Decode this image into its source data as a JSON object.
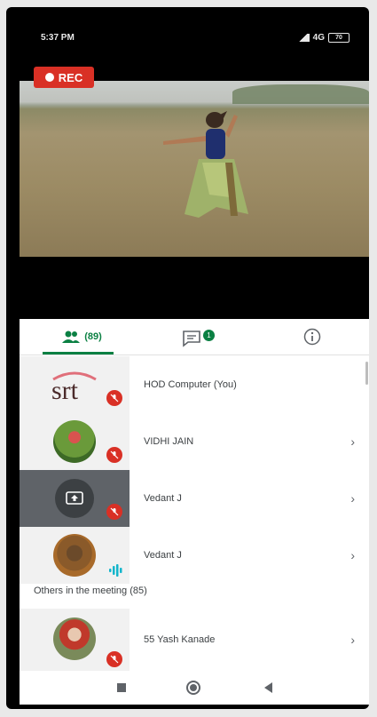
{
  "status_bar": {
    "time": "5:37 PM",
    "network": "4G",
    "battery": "70"
  },
  "recording": {
    "label": "REC"
  },
  "tabs": {
    "people_count": "(89)",
    "chat_badge": "1"
  },
  "participants": [
    {
      "name": "HOD Computer (You)",
      "avatar": "srt-logo",
      "muted": true
    },
    {
      "name": "VIDHI JAIN",
      "avatar": "photo",
      "muted": true
    },
    {
      "name": "Vedant J",
      "avatar": "screen-share-icon",
      "muted": true
    },
    {
      "name": "Vedant J",
      "avatar": "photo",
      "muted": false
    }
  ],
  "others": {
    "heading": "Others in the meeting (85)",
    "items": [
      {
        "name": "55 Yash Kanade",
        "muted": true
      }
    ]
  },
  "logo_text": "srt",
  "colors": {
    "accent": "#0b8043",
    "mute": "#d93025",
    "rec": "#d93025"
  }
}
